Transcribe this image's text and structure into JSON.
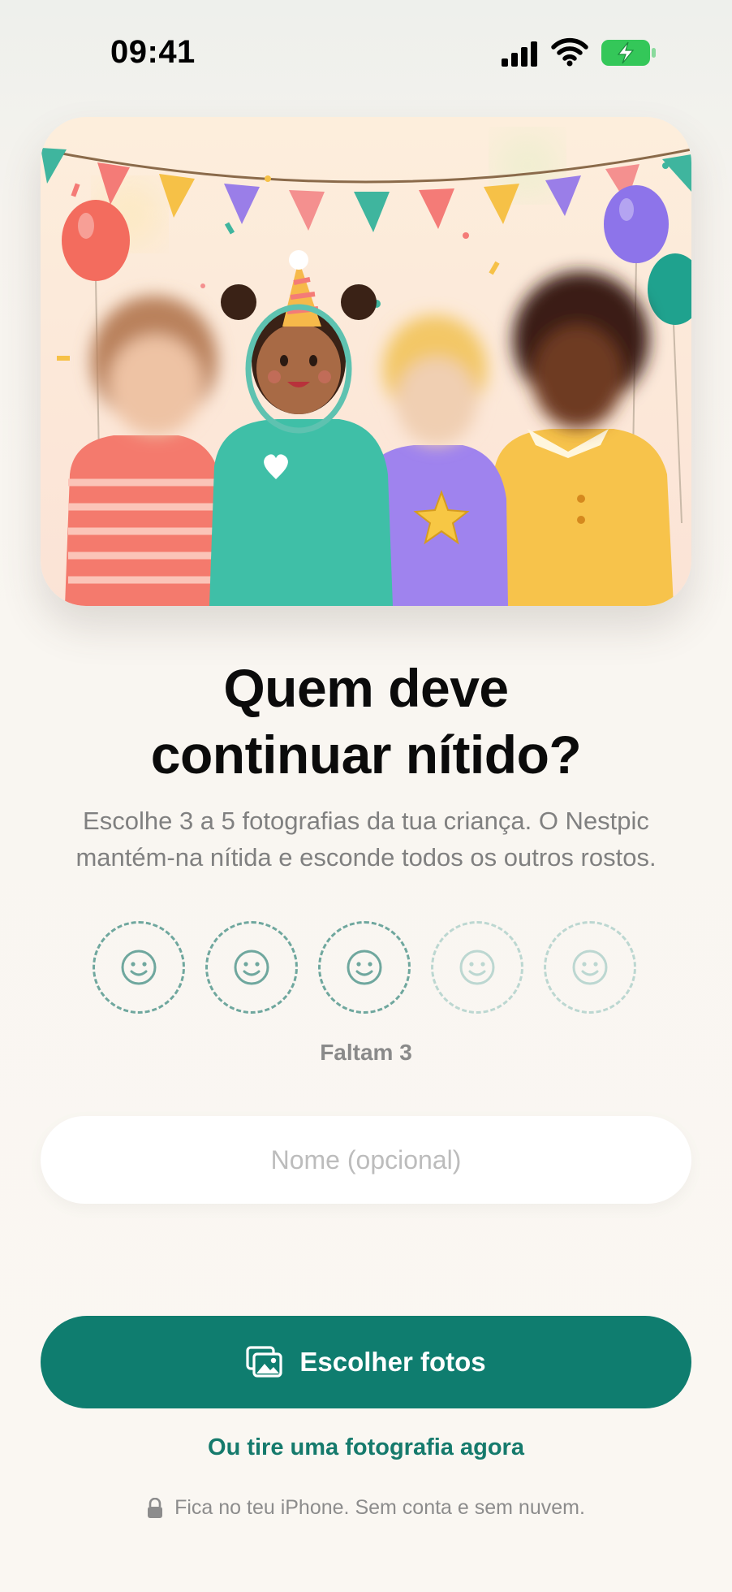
{
  "status_bar": {
    "time": "09:41",
    "icons": [
      "signal-icon",
      "wifi-icon",
      "battery-charging-icon"
    ]
  },
  "hero": {
    "illustration": "party-children-illustration",
    "colors": {
      "background": "#fdebd9",
      "highlight_ring": "#5ec2b0"
    }
  },
  "headline": {
    "line1": "Quem deve",
    "line2": "continuar nítido?"
  },
  "subtitle": "Escolhe 3 a 5 fotografias da tua criança. O Nestpic mantém-na nítida e esconde todos os outros rostos.",
  "photo_slots": {
    "icon": "smiley-face-icon",
    "total": 5,
    "required": 3,
    "remaining_label": "Faltam 3"
  },
  "name_field": {
    "placeholder": "Nome (opcional)",
    "value": ""
  },
  "actions": {
    "primary_label": "Escolher fotos",
    "primary_icon": "photos-icon",
    "secondary_label": "Ou tire uma fotografia agora"
  },
  "privacy": {
    "icon": "lock-icon",
    "text": "Fica no teu iPhone. Sem conta e sem nuvem."
  },
  "colors": {
    "accent": "#0f7d6f",
    "link": "#157a6c",
    "slot_active": "#6fa79e",
    "slot_inactive": "#bcd7d1"
  }
}
